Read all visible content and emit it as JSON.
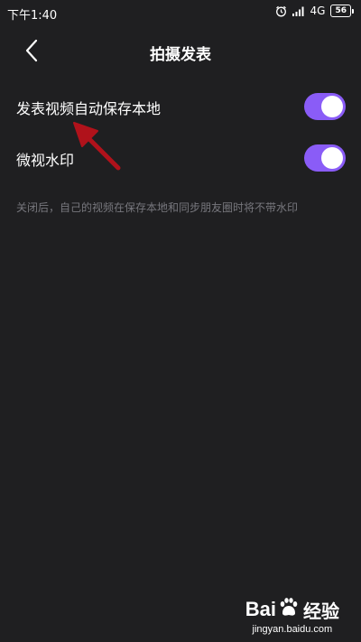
{
  "status_bar": {
    "time": "下午1:40",
    "network": "4G",
    "battery": "56"
  },
  "header": {
    "title": "拍摄发表"
  },
  "settings": [
    {
      "label": "发表视频自动保存本地",
      "enabled": true
    },
    {
      "label": "微视水印",
      "enabled": true
    }
  ],
  "description": "关闭后，自己的视频在保存本地和同步朋友圈时将不带水印",
  "colors": {
    "background": "#1f1f21",
    "toggle_on": "#8a5cf7",
    "description_text": "#77777d",
    "annotation_arrow": "#b0121b"
  },
  "watermark": {
    "logo_text_left": "Bai",
    "logo_text_right": "经验",
    "url": "jingyan.baidu.com"
  }
}
